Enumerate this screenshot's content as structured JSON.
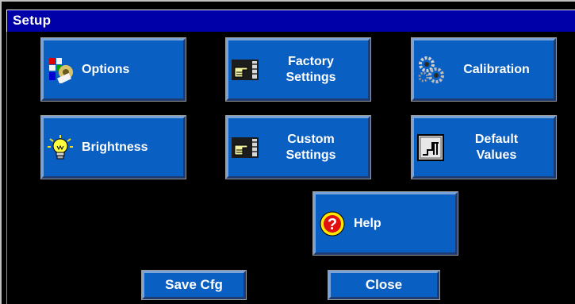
{
  "window": {
    "title": "Setup"
  },
  "tiles": {
    "options": {
      "label": "Options",
      "icon": "palette-gear-icon"
    },
    "factory": {
      "label": "Factory\nSettings",
      "icon": "pointing-hand-icon"
    },
    "calibration": {
      "label": "Calibration",
      "icon": "gears-icon"
    },
    "brightness": {
      "label": "Brightness",
      "icon": "lightbulb-icon"
    },
    "custom": {
      "label": "Custom\nSettings",
      "icon": "pointing-hand-icon"
    },
    "defaults": {
      "label": "Default\nValues",
      "icon": "step-graph-icon"
    },
    "help": {
      "label": "Help",
      "icon": "question-mark-icon"
    }
  },
  "buttons": {
    "save": "Save Cfg",
    "close": "Close"
  },
  "colors": {
    "title_bar": "#0000a8",
    "tile": "#0a5fc2",
    "background": "#000000"
  }
}
